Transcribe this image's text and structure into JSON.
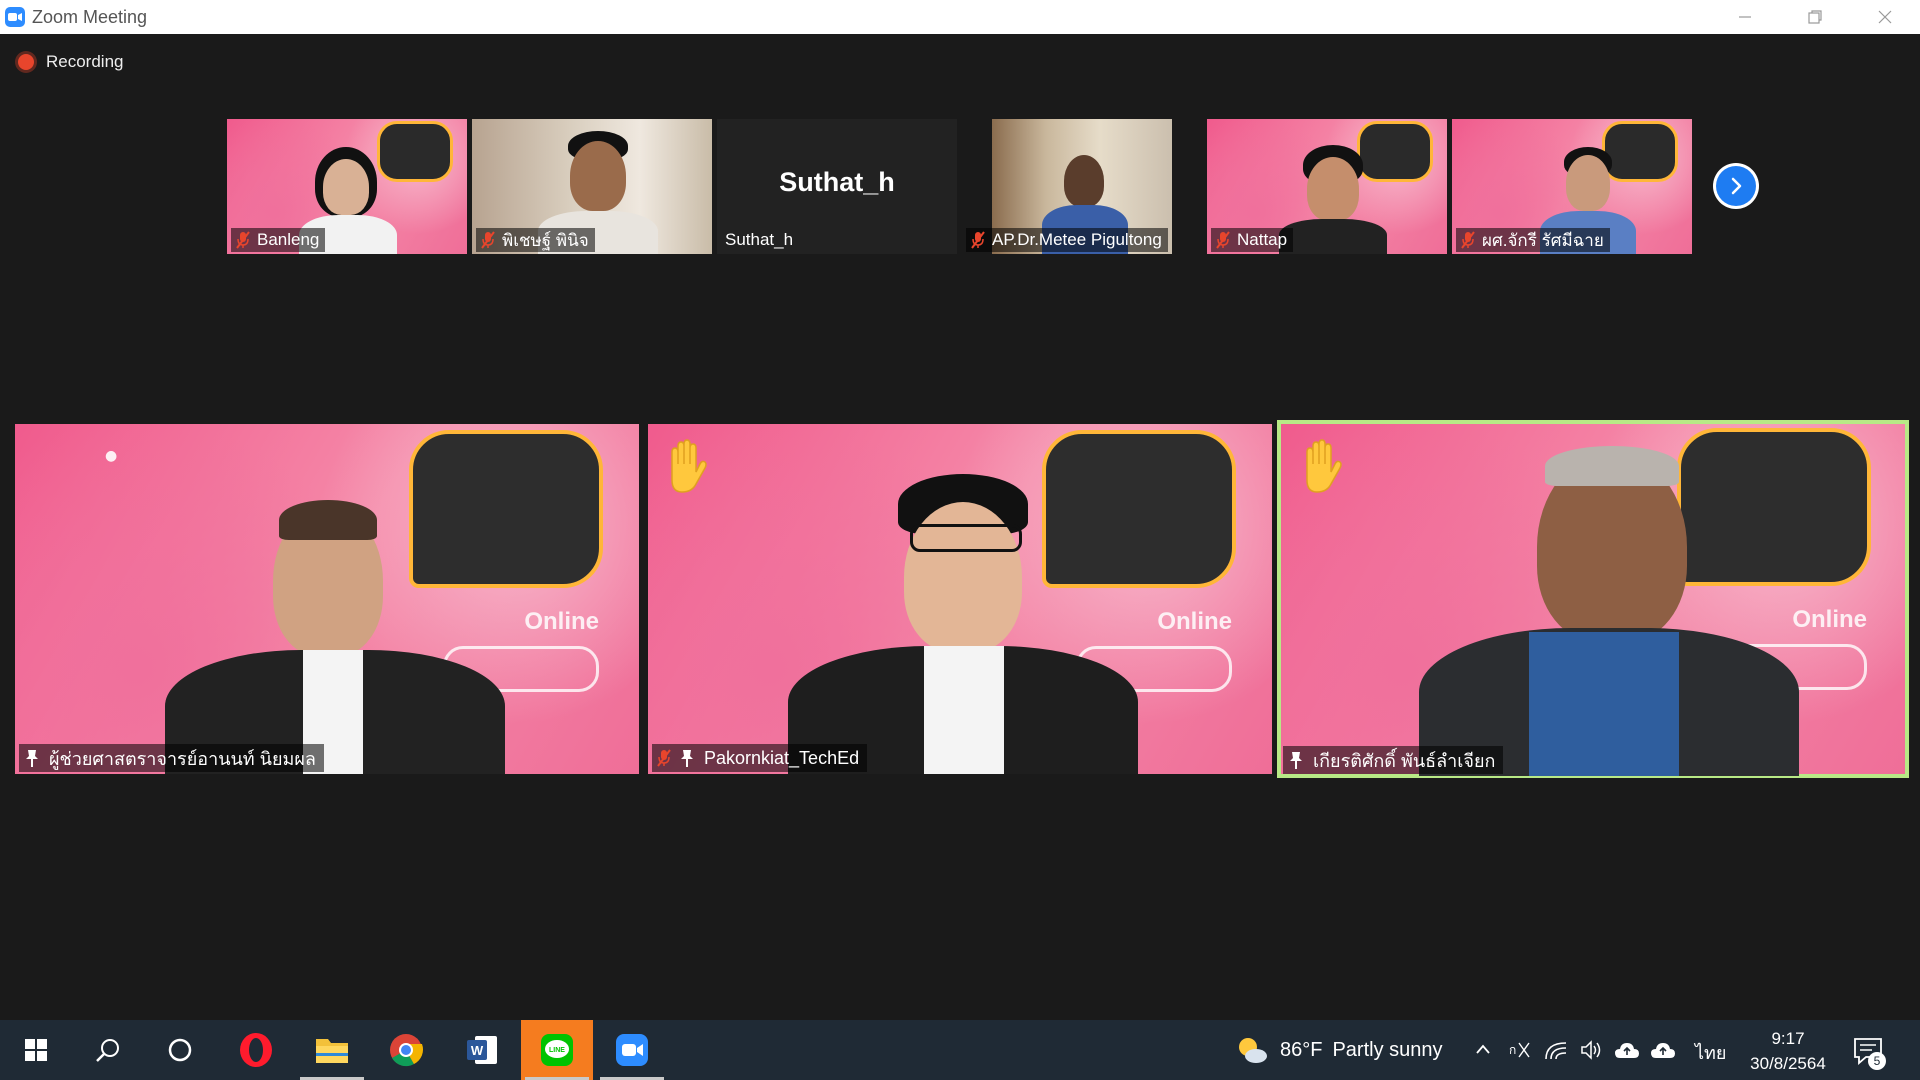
{
  "window": {
    "title": "Zoom Meeting"
  },
  "recording": {
    "label": "Recording"
  },
  "filmstrip": [
    {
      "name": "Banleng",
      "muted": true
    },
    {
      "name": "พิเชษฐ์ พินิจ",
      "muted": true
    },
    {
      "name": "Suthat_h",
      "muted": false,
      "video_off_label": "Suthat_h"
    },
    {
      "name": "AP.Dr.Metee Pigultong",
      "muted": true
    },
    {
      "name": "Nattap",
      "muted": true
    },
    {
      "name": "ผศ.จักรี รัศมีฉาย",
      "muted": true
    }
  ],
  "main_tiles": [
    {
      "name": "ผู้ช่วยศาสตราจารย์อานนท์ นิยมผล",
      "muted": false,
      "pinned": true,
      "raised_hand": false,
      "active_speaker": false
    },
    {
      "name": "Pakornkiat_TechEd",
      "muted": true,
      "pinned": true,
      "raised_hand": true,
      "active_speaker": false
    },
    {
      "name": "เกียรติศักดิ์ พันธ์ลำเจียก",
      "muted": false,
      "pinned": true,
      "raised_hand": true,
      "active_speaker": true
    }
  ],
  "background_text": {
    "online": "Online"
  },
  "taskbar": {
    "weather": {
      "temp": "86°F",
      "condition": "Partly sunny"
    },
    "language": "ไทย",
    "time": "9:17",
    "date": "30/8/2564",
    "notification_count": "5"
  },
  "colors": {
    "active_speaker_border": "#b8e986",
    "zoom_blue": "#2d8cff",
    "line_green": "#00c300",
    "taskbar_bg": "#1f2a35"
  }
}
